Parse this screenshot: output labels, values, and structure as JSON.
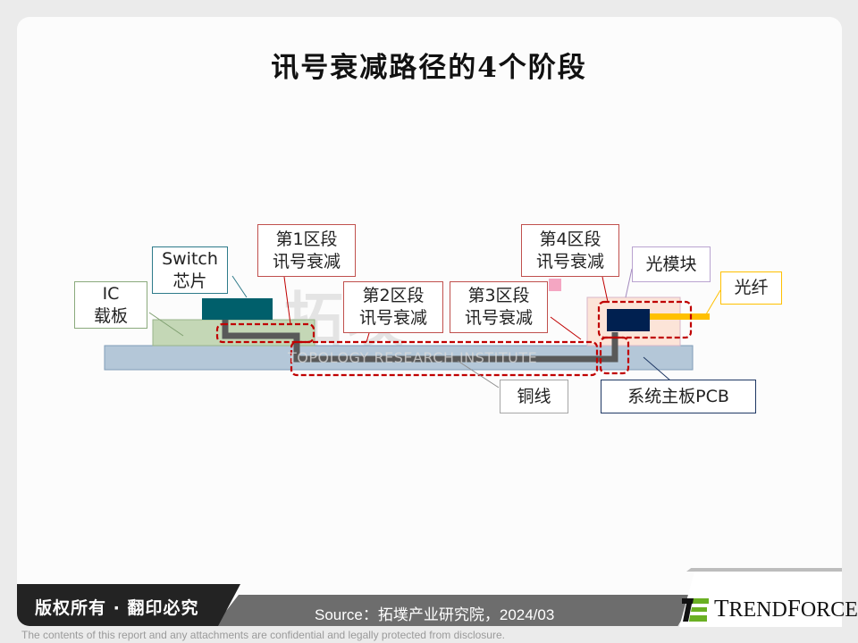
{
  "title": "讯号衰减路径的4个阶段",
  "diagram": {
    "components": {
      "ic_substrate": {
        "label_line1": "IC",
        "label_line2": "载板",
        "fill": "#c4d7b6"
      },
      "switch_chip": {
        "label_line1": "Switch",
        "label_line2": "芯片",
        "fill": "#005f6b"
      },
      "optical_module": {
        "label": "光模块",
        "fill": "#fce4d8"
      },
      "optical_fiber": {
        "label": "光纤",
        "fill": "#ffc000"
      },
      "system_pcb": {
        "label": "系统主板PCB",
        "fill": "#b4c7d8"
      },
      "copper_wire": {
        "label": "铜线",
        "fill": "#595959"
      },
      "transceiver": {
        "fill": "#002050"
      }
    },
    "stages": [
      {
        "line1": "第1区段",
        "line2": "讯号衰减"
      },
      {
        "line1": "第2区段",
        "line2": "讯号衰减"
      },
      {
        "line1": "第3区段",
        "line2": "讯号衰减"
      },
      {
        "line1": "第4区段",
        "line2": "讯号衰减"
      }
    ],
    "stage_color": "#c00000",
    "watermark_cn": "拓墣",
    "watermark_en": "TOPOLOGY RESEARCH INSTITUTE"
  },
  "footer": {
    "copyright": "版权所有 · 翻印必究",
    "source": "Source：拓墣产业研究院，2024/03",
    "logo_text_first": "T",
    "logo_text_rest1": "REND",
    "logo_text_mid": "F",
    "logo_text_rest2": "ORCE",
    "disclaimer": "The contents of this report and any attachments are confidential and legally protected from disclosure.",
    "logo_green": "#6ab023"
  }
}
